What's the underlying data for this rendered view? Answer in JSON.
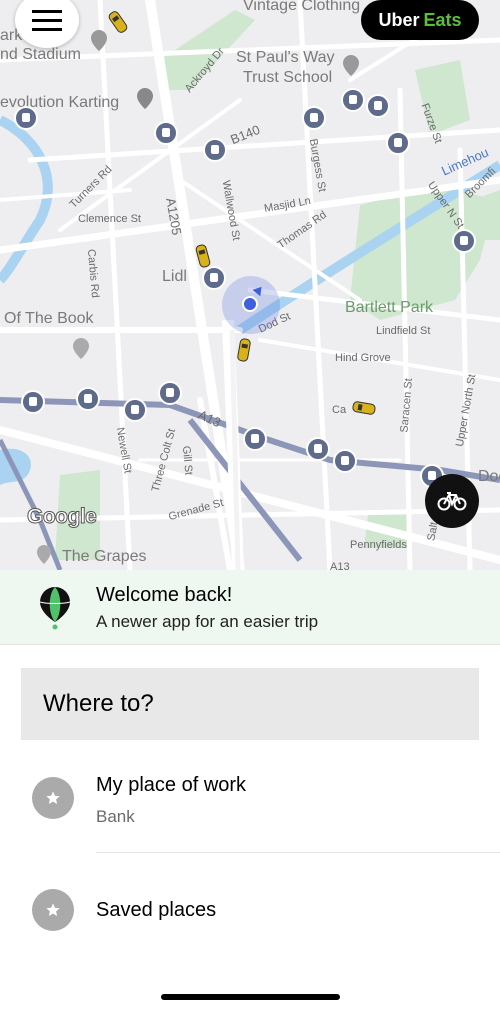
{
  "map": {
    "labels": {
      "park": "ark",
      "stadium": "nd Stadium",
      "vintage": "Vintage Clothing",
      "stpauls1": "St Paul's Way",
      "stpauls2": "Trust School",
      "evolution": "evolution Karting",
      "ackroyd": "Ackroyd Dr",
      "b140": "B140",
      "furze": "Furze St",
      "burgess": "Burgess St",
      "limehouse": "Limehou",
      "turners": "Turners Rd",
      "clemence": "Clemence St",
      "a1205": "A1205",
      "wallwood": "Wallwood St",
      "masjid": "Masjid Ln",
      "thomas": "Thomas Rd",
      "upper_n": "Upper N St",
      "broomfi": "Broomfi",
      "carbis": "Carbis Rd",
      "lidl": "Lidl",
      "bartlett": "Bartlett Park",
      "book": "Of The Book",
      "dod": "Dod St",
      "lindfield": "Lindfield St",
      "hind": "Hind Grove",
      "saracen": "Saracen St",
      "upper_north": "Upper North St",
      "ca": "Ca",
      "a13": "A13",
      "newell": "Newell St",
      "threecolt": "Three Colt St",
      "gill": "Gill St",
      "grenade": "Grenade St",
      "pennyfields": "Pennyfields",
      "grapes": "The Grapes",
      "doc": "Doc",
      "salt": "Salt",
      "a13b": "A13"
    },
    "google": "Google"
  },
  "header": {
    "menu_icon": "hamburger-icon",
    "uber_eats_word1": "Uber",
    "uber_eats_word2": "Eats"
  },
  "banner": {
    "title": "Welcome back!",
    "subtitle": "A newer app for an easier trip"
  },
  "search": {
    "label": "Where to?"
  },
  "places": [
    {
      "title": "My place of work",
      "subtitle": "Bank",
      "icon": "star-icon"
    },
    {
      "title": "Saved places",
      "icon": "star-icon"
    }
  ],
  "colors": {
    "accent_green": "#5bbf3b",
    "banner_bg": "#eff7f1",
    "bus_pin": "#5f6b8b",
    "location": "#3f5fdc"
  }
}
